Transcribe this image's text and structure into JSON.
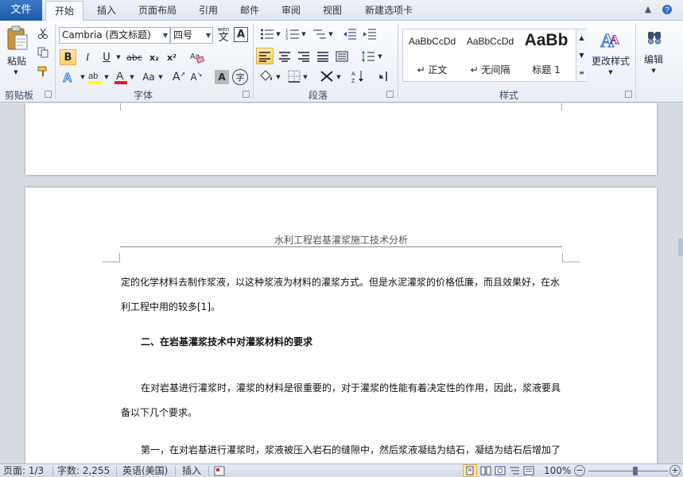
{
  "tabs": {
    "file": "文件",
    "items": [
      "开始",
      "插入",
      "页面布局",
      "引用",
      "邮件",
      "审阅",
      "视图",
      "新建选项卡"
    ],
    "active": "开始"
  },
  "ribbon": {
    "clipboard": {
      "paste": "粘贴",
      "group": "剪贴板"
    },
    "font": {
      "font_name": "Cambria (西文标题)",
      "font_size": "四号",
      "wen": "wén",
      "bold": "B",
      "italic": "I",
      "underline": "U",
      "strike": "abc",
      "sub": "x₂",
      "sup": "x²",
      "case": "Aa",
      "grow": "A",
      "shrink": "A",
      "char_border": "A",
      "phonetic": "字",
      "group": "字体"
    },
    "paragraph": {
      "group": "段落"
    },
    "styles": {
      "items": [
        {
          "sample": "AaBbCcDd",
          "name": "↵ 正文"
        },
        {
          "sample": "AaBbCcDd",
          "name": "↵ 无间隔"
        },
        {
          "sample": "AaBb",
          "name": "标题 1"
        }
      ],
      "change_styles": "更改样式",
      "group": "样式"
    },
    "editing": {
      "label": "编辑"
    }
  },
  "document": {
    "header": "水利工程岩基灌浆施工技术分析",
    "lines": [
      "定的化学材料去制作浆液，以这种浆液为材料的灌浆方式。但是水泥灌浆的价格低廉，而且效果好，在水",
      "利工程中用的较多[1]。",
      "二、在岩基灌浆技术中对灌浆材料的要求",
      "在对岩基进行灌浆时，灌浆的材料是很重要的，对于灌浆的性能有着决定性的作用，因此，浆液要具",
      "备以下几个要求。",
      "第一，在对岩基进行灌浆时，浆液被压入岩石的缝隙中，然后浆液凝结为结石，凝结为结石后增加了"
    ]
  },
  "statusbar": {
    "page": "页面: 1/3",
    "words": "字数: 2,255",
    "language": "英语(美国)",
    "mode": "插入",
    "zoom": "100%",
    "zoom_level": 1.0
  }
}
